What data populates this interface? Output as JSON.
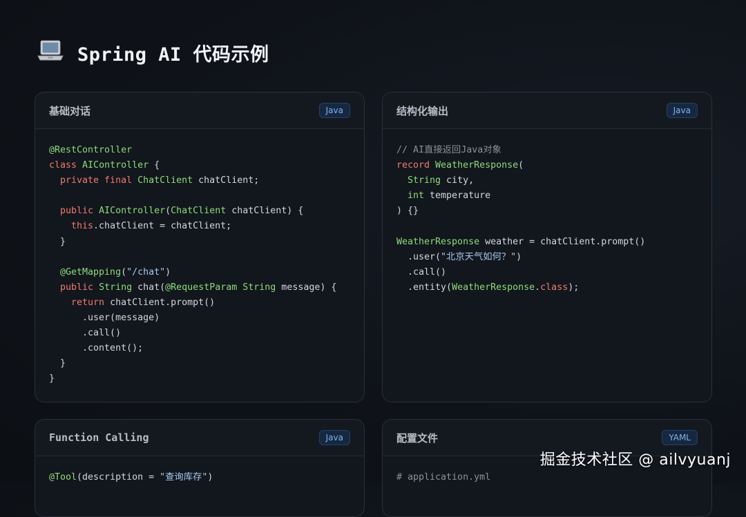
{
  "page": {
    "title": "Spring AI 代码示例",
    "icon": "laptop-icon"
  },
  "cards": [
    {
      "title": "基础对话",
      "badge": "Java",
      "lines": [
        [
          {
            "t": "@RestController",
            "c": "ann"
          }
        ],
        [
          {
            "t": "class ",
            "c": "kw"
          },
          {
            "t": "AIController",
            "c": "ty"
          },
          {
            "t": " {",
            "c": ""
          }
        ],
        [
          {
            "t": "  private final ",
            "c": "kw"
          },
          {
            "t": "ChatClient",
            "c": "ty"
          },
          {
            "t": " chatClient;",
            "c": ""
          }
        ],
        [
          {
            "t": "",
            "c": ""
          }
        ],
        [
          {
            "t": "  public ",
            "c": "kw"
          },
          {
            "t": "AIController",
            "c": "ty"
          },
          {
            "t": "(",
            "c": ""
          },
          {
            "t": "ChatClient",
            "c": "ty"
          },
          {
            "t": " chatClient) {",
            "c": ""
          }
        ],
        [
          {
            "t": "    this",
            "c": "kw"
          },
          {
            "t": ".chatClient = chatClient;",
            "c": ""
          }
        ],
        [
          {
            "t": "  }",
            "c": ""
          }
        ],
        [
          {
            "t": "",
            "c": ""
          }
        ],
        [
          {
            "t": "  @GetMapping",
            "c": "ann"
          },
          {
            "t": "(",
            "c": ""
          },
          {
            "t": "\"/chat\"",
            "c": "str"
          },
          {
            "t": ")",
            "c": ""
          }
        ],
        [
          {
            "t": "  public ",
            "c": "kw"
          },
          {
            "t": "String",
            "c": "ty"
          },
          {
            "t": " chat(",
            "c": ""
          },
          {
            "t": "@RequestParam",
            "c": "ann"
          },
          {
            "t": " ",
            "c": ""
          },
          {
            "t": "String",
            "c": "ty"
          },
          {
            "t": " message) {",
            "c": ""
          }
        ],
        [
          {
            "t": "    return ",
            "c": "kw"
          },
          {
            "t": "chatClient.prompt()",
            "c": ""
          }
        ],
        [
          {
            "t": "      .user(message)",
            "c": ""
          }
        ],
        [
          {
            "t": "      .call()",
            "c": ""
          }
        ],
        [
          {
            "t": "      .content();",
            "c": ""
          }
        ],
        [
          {
            "t": "  }",
            "c": ""
          }
        ],
        [
          {
            "t": "}",
            "c": ""
          }
        ]
      ]
    },
    {
      "title": "结构化输出",
      "badge": "Java",
      "lines": [
        [
          {
            "t": "// AI直接返回Java对象",
            "c": "cm"
          }
        ],
        [
          {
            "t": "record ",
            "c": "kw"
          },
          {
            "t": "WeatherResponse",
            "c": "ty"
          },
          {
            "t": "(",
            "c": ""
          }
        ],
        [
          {
            "t": "  String",
            "c": "ty"
          },
          {
            "t": " city,",
            "c": ""
          }
        ],
        [
          {
            "t": "  int",
            "c": "ty"
          },
          {
            "t": " temperature",
            "c": ""
          }
        ],
        [
          {
            "t": ") {}",
            "c": ""
          }
        ],
        [
          {
            "t": "",
            "c": ""
          }
        ],
        [
          {
            "t": "WeatherResponse",
            "c": "ty"
          },
          {
            "t": " weather = chatClient.prompt()",
            "c": ""
          }
        ],
        [
          {
            "t": "  .user(",
            "c": ""
          },
          {
            "t": "\"北京天气如何？\"",
            "c": "str"
          },
          {
            "t": ")",
            "c": ""
          }
        ],
        [
          {
            "t": "  .call()",
            "c": ""
          }
        ],
        [
          {
            "t": "  .entity(",
            "c": ""
          },
          {
            "t": "WeatherResponse",
            "c": "ty"
          },
          {
            "t": ".",
            "c": ""
          },
          {
            "t": "class",
            "c": "kw"
          },
          {
            "t": ");",
            "c": ""
          }
        ]
      ]
    },
    {
      "title": "Function Calling",
      "badge": "Java",
      "lines": [
        [
          {
            "t": "@Tool",
            "c": "ann"
          },
          {
            "t": "(description = ",
            "c": ""
          },
          {
            "t": "\"查询库存\"",
            "c": "str"
          },
          {
            "t": ")",
            "c": ""
          }
        ]
      ]
    },
    {
      "title": "配置文件",
      "badge": "YAML",
      "lines": [
        [
          {
            "t": "# application.yml",
            "c": "cm"
          }
        ]
      ]
    }
  ],
  "watermark": "掘金技术社区 @ ailvyuanj"
}
